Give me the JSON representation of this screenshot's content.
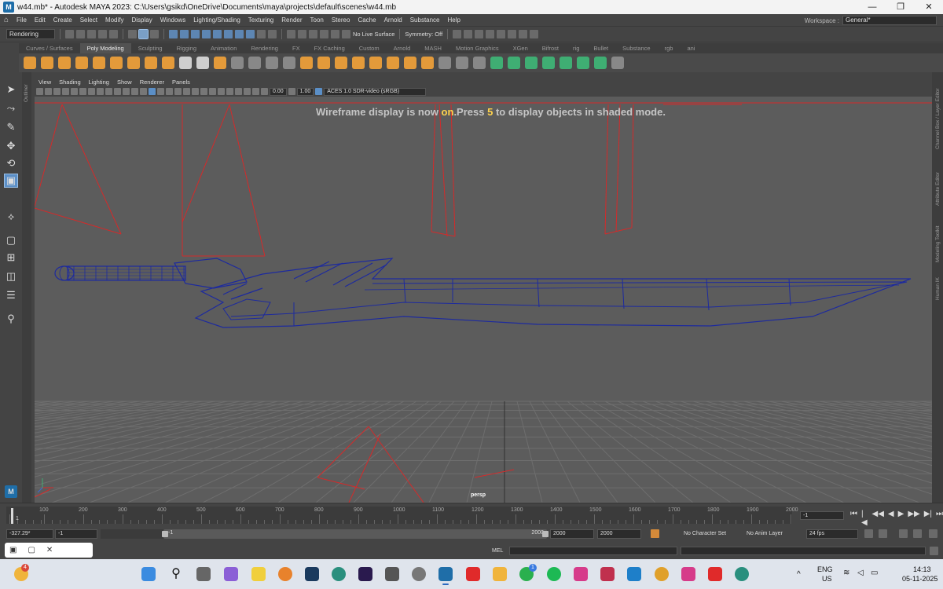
{
  "window": {
    "title": "w44.mb* - Autodesk MAYA 2023: C:\\Users\\gsikd\\OneDrive\\Documents\\maya\\projects\\default\\scenes\\w44.mb",
    "app_icon": "M",
    "min": "—",
    "max": "❐",
    "close": "✕"
  },
  "menubar": {
    "items": [
      "File",
      "Edit",
      "Create",
      "Select",
      "Modify",
      "Display",
      "Windows",
      "Lighting/Shading",
      "Texturing",
      "Render",
      "Toon",
      "Stereo",
      "Cache",
      "Arnold",
      "Substance",
      "Help"
    ],
    "workspace_label": "Workspace :",
    "workspace_value": "General*"
  },
  "statusline": {
    "mode": "Rendering",
    "live_surface": "No Live Surface",
    "symmetry": "Symmetry: Off"
  },
  "shelf": {
    "tabs": [
      "Curves / Surfaces",
      "Poly Modeling",
      "Sculpting",
      "Rigging",
      "Animation",
      "Rendering",
      "FX",
      "FX Caching",
      "Custom",
      "Arnold",
      "MASH",
      "Motion Graphics",
      "XGen",
      "Bifrost",
      "rig",
      "Bullet",
      "Substance",
      "rgb",
      "ani"
    ],
    "active_tab": "Poly Modeling"
  },
  "side_labels": {
    "outliner": "Outliner",
    "right": [
      "Channel Box / Layer Editor",
      "Attribute Editor",
      "Modeling Toolkit",
      "Human IK"
    ]
  },
  "panel": {
    "menus": [
      "View",
      "Shading",
      "Lighting",
      "Show",
      "Renderer",
      "Panels"
    ],
    "exposure": "0.00",
    "gamma": "1.00",
    "color_space": "ACES 1.0 SDR-video (sRGB)"
  },
  "viewport": {
    "hud_prefix": "Wireframe display is now ",
    "hud_on": "on",
    "hud_middle": ".Press ",
    "hud_key": "5",
    "hud_suffix": " to display objects in shaded mode.",
    "camera": "persp",
    "wire_color": "#1d2a9e",
    "joint_color": "#d42a2a"
  },
  "timeslider": {
    "ticks": [
      "1",
      "100",
      "200",
      "300",
      "400",
      "500",
      "600",
      "700",
      "800",
      "900",
      "1000",
      "1100",
      "1200",
      "1300",
      "1400",
      "1500",
      "1600",
      "1700",
      "1800",
      "1900",
      "2000"
    ],
    "current_frame": "1",
    "current_field": "-1",
    "playback_buttons": [
      "⏮",
      "|◀",
      "◀◀",
      "◀",
      "▶",
      "▶▶",
      "▶|",
      "⏭"
    ]
  },
  "range": {
    "current_time": "-327.29*",
    "start": "-1",
    "handle_start": "-1",
    "handle_end": "2000",
    "end": "2000",
    "anim_end": "2000",
    "character_set": "No Character Set",
    "anim_layer": "No Anim Layer",
    "fps": "24 fps"
  },
  "cmdline": {
    "lang": "MEL"
  },
  "taskbar": {
    "lang": "ENG",
    "region": "US",
    "time": "14:13",
    "date": "05-11-2025",
    "weather_badge": "4",
    "whatsapp_badge": "1"
  }
}
